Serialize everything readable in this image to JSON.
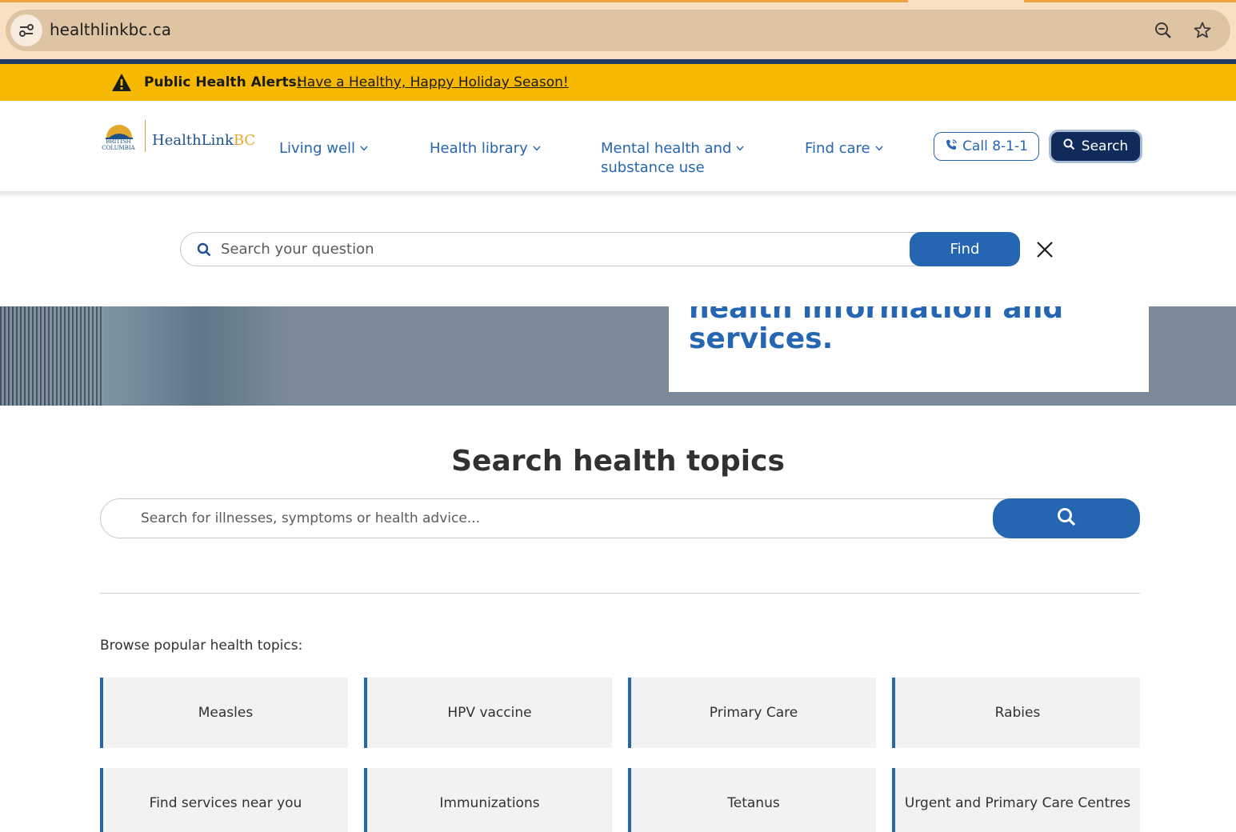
{
  "browser": {
    "url": "healthlinkbc.ca",
    "icons": [
      "site-info-icon",
      "zoom-icon",
      "bookmark-star-icon"
    ]
  },
  "alert": {
    "label": "Public Health Alerts:",
    "link": "Have a Healthy, Happy Holiday Season!",
    "icon": "warning-icon"
  },
  "header": {
    "logo_gov_line1": "BRITISH",
    "logo_gov_line2": "COLUMBIA",
    "logo_name": "HealthLink",
    "logo_name_suffix": "BC",
    "nav": [
      {
        "label": "Living well"
      },
      {
        "label": "Health library"
      },
      {
        "label_line1": "Mental health and",
        "label_line2": "substance use"
      },
      {
        "label": "Find care"
      }
    ],
    "call_label": "Call 8-1-1",
    "search_label": "Search"
  },
  "search_overlay": {
    "placeholder": "Search your question",
    "find_label": "Find"
  },
  "hero": {
    "partial_line": "health information and",
    "last_line": "services."
  },
  "topics": {
    "title": "Search health topics",
    "placeholder": "Search for illnesses, symptoms or health advice...",
    "browse_label": "Browse popular health topics:",
    "tiles": [
      "Measles",
      "HPV vaccine",
      "Primary Care",
      "Rabies",
      "Find services near you",
      "Immunizations",
      "Tetanus",
      "Urgent and Primary Care Centres"
    ]
  },
  "colors": {
    "brand_blue": "#2566b3",
    "navy": "#102b59",
    "alert_yellow": "#f6b800"
  }
}
